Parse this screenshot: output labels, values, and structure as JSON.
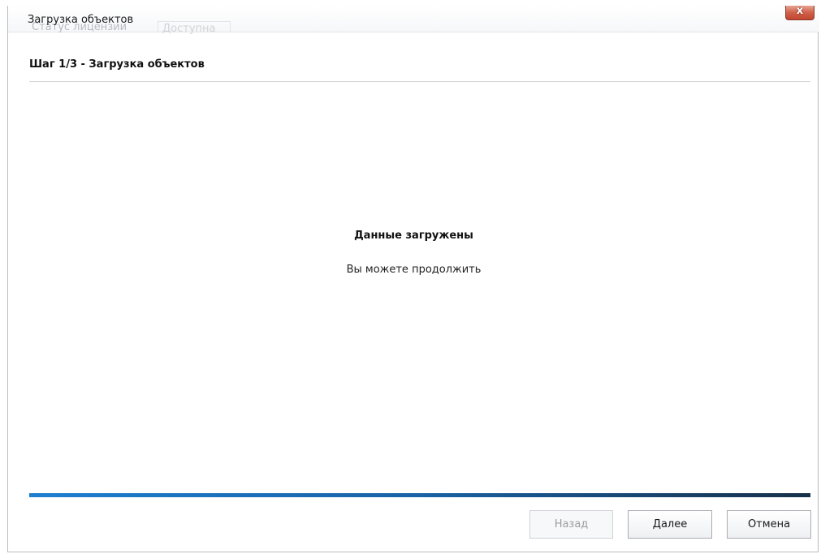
{
  "window": {
    "title": "Загрузка объектов",
    "close_label": "x",
    "background_tabs": [
      "Статус лицензии",
      "Доступна"
    ]
  },
  "wizard": {
    "step_title": "Шаг 1/3 - Загрузка объектов",
    "progress_fraction": 1.0,
    "message_title": "Данные загружены",
    "message_subtitle": "Вы можете продолжить"
  },
  "buttons": {
    "back_label": "Назад",
    "back_enabled": false,
    "next_label": "Далее",
    "cancel_label": "Отмена"
  },
  "colors": {
    "progress_start": "#1d7fd0",
    "progress_end": "#173049",
    "close_button": "#c2462f"
  }
}
